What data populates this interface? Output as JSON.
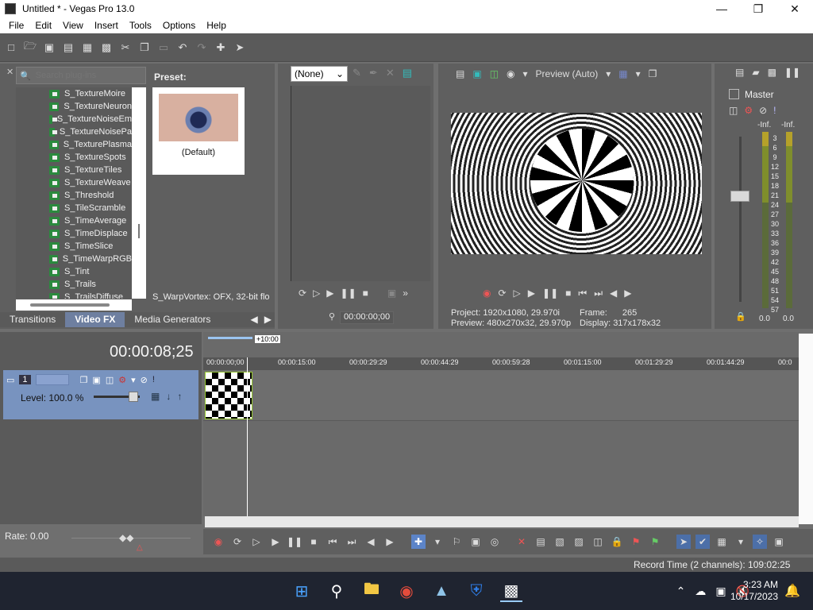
{
  "window": {
    "title": "Untitled * - Vegas Pro 13.0"
  },
  "menu": [
    "File",
    "Edit",
    "View",
    "Insert",
    "Tools",
    "Options",
    "Help"
  ],
  "plugins": {
    "search_placeholder": "Search plug-ins",
    "items": [
      "S_TextureMoire",
      "S_TextureNeuron",
      "S_TextureNoiseEm",
      "S_TextureNoisePa",
      "S_TexturePlasma",
      "S_TextureSpots",
      "S_TextureTiles",
      "S_TextureWeave",
      "S_Threshold",
      "S_TileScramble",
      "S_TimeAverage",
      "S_TimeDisplace",
      "S_TimeSlice",
      "S_TimeWarpRGB",
      "S_Tint",
      "S_Trails",
      "S_TrailsDiffuse"
    ],
    "preset_label": "Preset:",
    "preset_name": "(Default)",
    "status": "S_WarpVortex: OFX, 32-bit flo"
  },
  "tabs": [
    "Transitions",
    "Video FX",
    "Media Generators"
  ],
  "trimmer": {
    "select_value": "(None)",
    "timecode": "00:00:00;00"
  },
  "preview": {
    "quality": "Preview (Auto)",
    "project_label": "Project:",
    "project_value": "1920x1080, 29.970i",
    "preview_label": "Preview:",
    "preview_value": "480x270x32, 29.970p",
    "frame_label": "Frame:",
    "frame_value": "265",
    "display_label": "Display:",
    "display_value": "317x178x32"
  },
  "master": {
    "title": "Master",
    "inf_left": "-Inf.",
    "inf_right": "-Inf.",
    "scale": [
      "3",
      "6",
      "9",
      "12",
      "15",
      "18",
      "21",
      "24",
      "27",
      "30",
      "33",
      "36",
      "39",
      "42",
      "45",
      "48",
      "51",
      "54",
      "57"
    ],
    "bottom_left": "0.0",
    "bottom_right": "0.0"
  },
  "timeline": {
    "current_time": "00:00:08;25",
    "loop_marker": "+10:00",
    "ruler": [
      "00:00:00;00",
      "00:00:15:00",
      "00:00:29:29",
      "00:00:44:29",
      "00:00:59:28",
      "00:01:15:00",
      "00:01:29:29",
      "00:01:44:29",
      "00:0"
    ],
    "track_number": "1",
    "track_level": "Level: 100.0 %",
    "rate": "Rate: 0.00"
  },
  "status": {
    "record_time": "Record Time (2 channels): 109:02:25"
  },
  "clock": {
    "time": "3:23 AM",
    "date": "10/17/2023"
  }
}
